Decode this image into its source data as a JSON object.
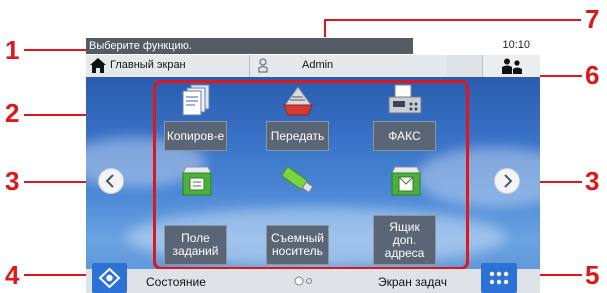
{
  "callouts": [
    "1",
    "2",
    "3",
    "3",
    "4",
    "5",
    "6",
    "7"
  ],
  "status": {
    "message": "Выберите функцию.",
    "time": "10:10"
  },
  "tabs": {
    "home": "Главный экран",
    "user": "Admin"
  },
  "functions": [
    {
      "label": "Копиров-е",
      "icon": "copy-icon"
    },
    {
      "label": "Передать",
      "icon": "send-icon"
    },
    {
      "label": "ФАКС",
      "icon": "fax-icon"
    },
    {
      "label": "Поле\nзаданий",
      "icon": "job-box-icon"
    },
    {
      "label": "Съемный\nноситель",
      "icon": "usb-drive-icon"
    },
    {
      "label": "Ящик\nдоп.\nадреса",
      "icon": "sub-address-box-icon"
    }
  ],
  "bottom": {
    "status": "Состояние",
    "task": "Экран задач"
  },
  "colors": {
    "callout": "#e0161b",
    "panel": "#2c5fb6",
    "tile": "#5a6576",
    "button": "#2c72d6"
  }
}
